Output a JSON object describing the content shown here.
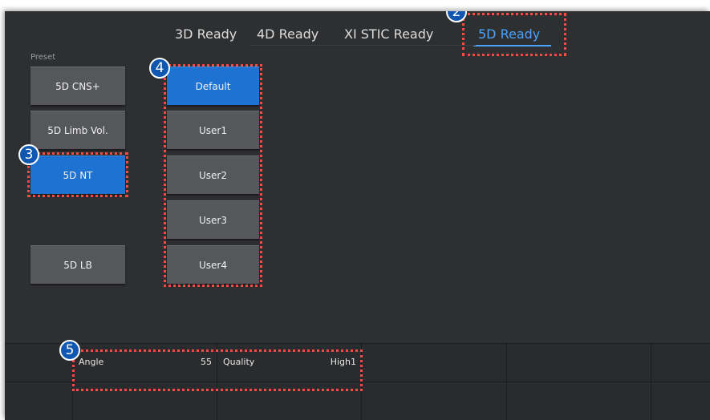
{
  "tabs": [
    {
      "label": "3D Ready",
      "active": false
    },
    {
      "label": "4D Ready",
      "active": false
    },
    {
      "label": "XI STIC Ready",
      "active": false
    },
    {
      "label": "5D Ready",
      "active": true
    }
  ],
  "preset": {
    "label": "Preset",
    "buttons": [
      "5D CNS+",
      "5D Limb Vol.",
      "5D NT",
      "5D LB"
    ],
    "active": "5D NT"
  },
  "user_presets": {
    "buttons": [
      "Default",
      "User1",
      "User2",
      "User3",
      "User4"
    ],
    "active": "Default"
  },
  "params": {
    "angle_label": "Angle",
    "angle_value": "55",
    "quality_label": "Quality",
    "quality_value": "High1"
  },
  "badges": {
    "b2": "2",
    "b3": "3",
    "b4": "4",
    "b5": "5"
  },
  "colors": {
    "accent": "#1e73d2",
    "tab_active": "#4aa3ff",
    "highlight": "#ff4a44",
    "badge": "#0f57b0",
    "background": "#2e2f31"
  }
}
